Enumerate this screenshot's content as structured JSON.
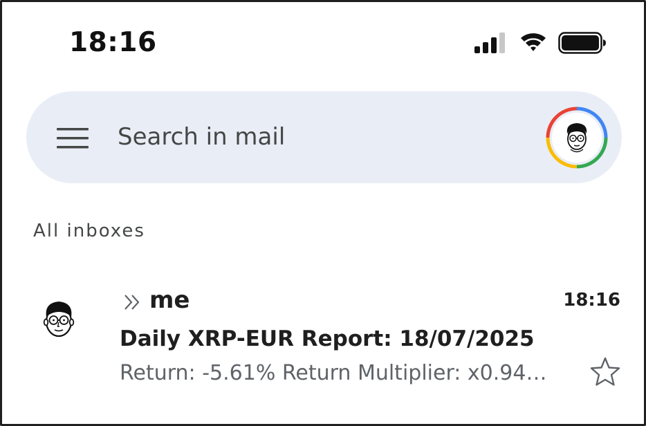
{
  "status_bar": {
    "time": "18:16",
    "icons": [
      "cellular-signal-icon",
      "wifi-icon",
      "battery-icon"
    ]
  },
  "search": {
    "placeholder": "Search in mail",
    "menu_icon": "hamburger-menu-icon",
    "account_icon": "account-avatar"
  },
  "section": {
    "label": "All inboxes"
  },
  "emails": [
    {
      "sender": "me",
      "time": "18:16",
      "subject": "Daily XRP-EUR Report: 18/07/2025",
      "snippet": "Return: -5.61% Return Multiplier: x0.94…",
      "important_marker": "double-chevron-icon",
      "starred": false
    }
  ],
  "colors": {
    "search_bar_bg": "#e9eef6",
    "text_primary": "#1f1f1f",
    "text_secondary": "#5f6368",
    "google_red": "#ea4335",
    "google_yellow": "#fbbc04",
    "google_green": "#34a853",
    "google_blue": "#4285f4"
  }
}
